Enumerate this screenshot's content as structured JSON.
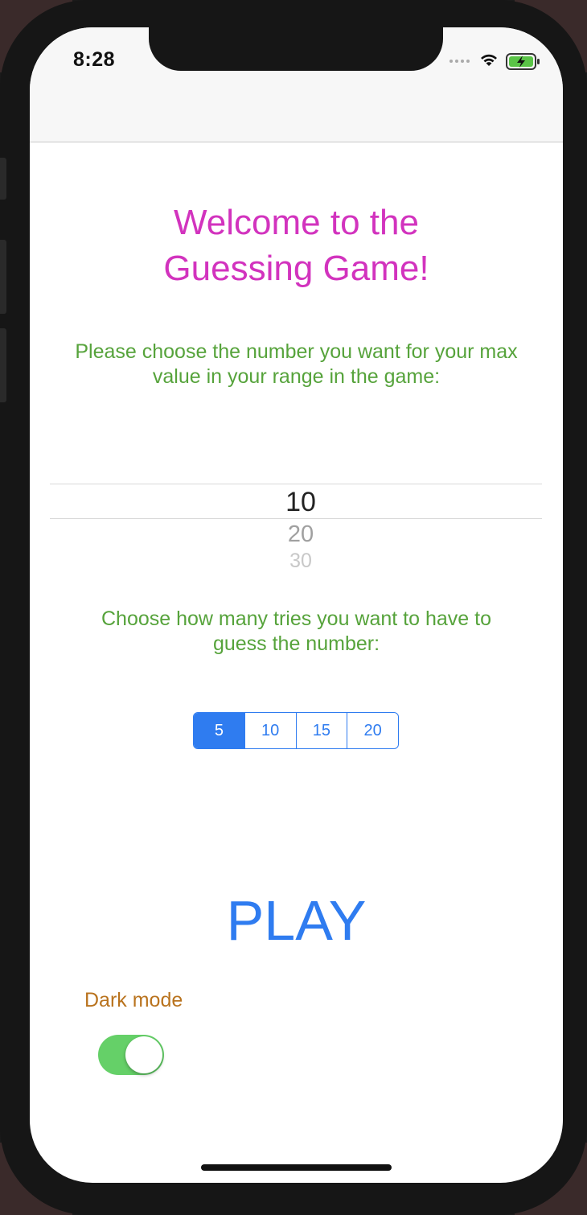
{
  "status_bar": {
    "time": "8:28"
  },
  "main": {
    "title": "Welcome to the\nGuessing Game!",
    "range_prompt": "Please choose the number you want for your max\nvalue in your range in the game:",
    "picker": {
      "items": [
        "10",
        "20",
        "30"
      ],
      "selected": "10"
    },
    "tries_prompt": "Choose how many tries you want to have to\nguess the number:",
    "tries_options": [
      "5",
      "10",
      "15",
      "20"
    ],
    "tries_selected": "5",
    "play_label": "PLAY",
    "dark_mode_label": "Dark mode",
    "dark_mode_on": true
  },
  "colors": {
    "title": "#d233be",
    "prompt": "#56a33b",
    "accent": "#2f7cf0",
    "dark_mode_label": "#b9731e",
    "toggle_on": "#65d068"
  }
}
